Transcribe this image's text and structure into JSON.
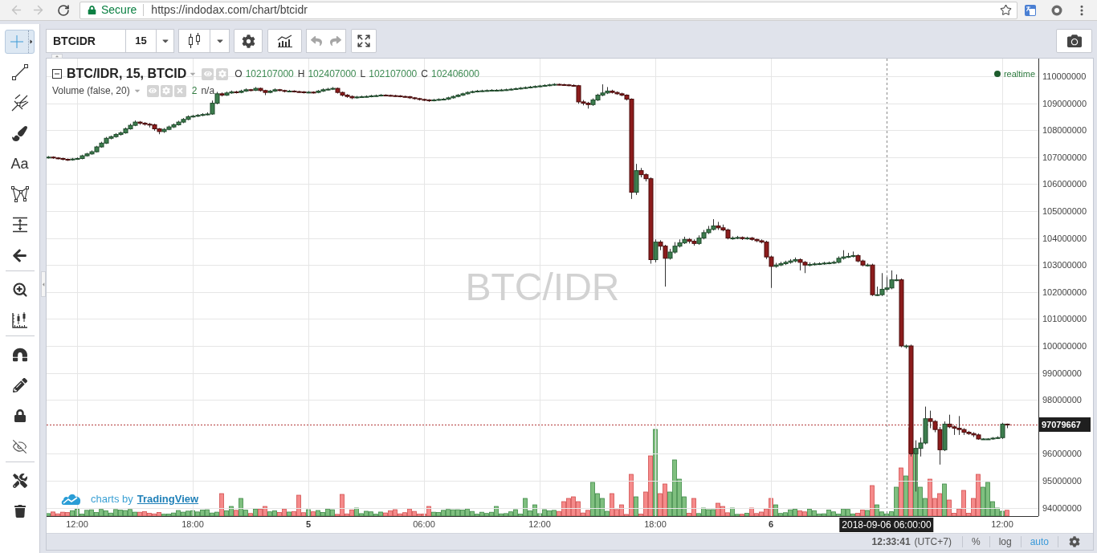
{
  "browser": {
    "nav_buttons": [
      {
        "disabled": true
      },
      {
        "disabled": true
      }
    ],
    "security_label": "Secure",
    "url": "https://indodax.com/chart/btcidr"
  },
  "top_toolbar": {
    "symbol": "BTCIDR",
    "interval": "15",
    "history_buttons": [
      {
        "disabled": true
      },
      {
        "disabled": true
      }
    ]
  },
  "left_toolbar": {
    "groups": [
      [
        {
          "kind": "icon",
          "selected": true
        },
        {
          "kind": "icon",
          "selected": false
        },
        {
          "kind": "icon",
          "selected": false
        },
        {
          "kind": "icon",
          "selected": false
        },
        {
          "kind": "text",
          "label": "Aa",
          "selected": false
        },
        {
          "kind": "icon",
          "selected": false
        },
        {
          "kind": "icon",
          "selected": false
        },
        {
          "kind": "icon",
          "selected": false
        }
      ],
      [
        {
          "kind": "icon",
          "selected": false
        },
        {
          "kind": "icon",
          "selected": false
        }
      ],
      [
        {
          "kind": "icon",
          "selected": false
        },
        {
          "kind": "icon",
          "selected": false
        },
        {
          "kind": "icon",
          "selected": false
        },
        {
          "kind": "icon",
          "selected": false
        }
      ],
      [
        {
          "kind": "icon",
          "selected": false
        },
        {
          "kind": "icon",
          "selected": false
        }
      ]
    ]
  },
  "legend": {
    "title": "BTC/IDR, 15, BTCID",
    "ohlc": [
      {
        "label": "O",
        "value": "102107000"
      },
      {
        "label": "H",
        "value": "102407000"
      },
      {
        "label": "L",
        "value": "102107000"
      },
      {
        "label": "C",
        "value": "102406000"
      }
    ],
    "volume_title": "Volume (false, 20)",
    "volume_value": "2",
    "volume_note": "n/a"
  },
  "realtime_label": "realtime",
  "watermark": "BTC/IDR",
  "attribution": {
    "text": "charts by",
    "link": "TradingView"
  },
  "price_chart": {
    "crosshair_time": "2018-09-06 06:00:00",
    "last_price": "97079667",
    "chart_data": {
      "type": "candlestick",
      "grid": true,
      "xlim": [
        "2018-09-04 10:25:00",
        "2018-09-06 13:52:30"
      ],
      "ylim": [
        93690500,
        110654800
      ],
      "xticks": [
        {
          "value": "2018-09-04 12:00",
          "label": "12:00"
        },
        {
          "value": "2018-09-04 18:00",
          "label": "18:00"
        },
        {
          "value": "2018-09-05 00:00",
          "label": "5"
        },
        {
          "value": "2018-09-05 06:00",
          "label": "06:00"
        },
        {
          "value": "2018-09-05 12:00",
          "label": "12:00"
        },
        {
          "value": "2018-09-05 18:00",
          "label": "18:00"
        },
        {
          "value": "2018-09-06 00:00",
          "label": "6"
        },
        {
          "value": "2018-09-06 12:00",
          "label": "12:00"
        }
      ],
      "yticks": [
        {
          "value": 110000000,
          "label": "110000000"
        },
        {
          "value": 109000000,
          "label": "109000000"
        },
        {
          "value": 108000000,
          "label": "108000000"
        },
        {
          "value": 107000000,
          "label": "107000000"
        },
        {
          "value": 106000000,
          "label": "106000000"
        },
        {
          "value": 105000000,
          "label": "105000000"
        },
        {
          "value": 104000000,
          "label": "104000000"
        },
        {
          "value": 103000000,
          "label": "103000000"
        },
        {
          "value": 102000000,
          "label": "102000000"
        },
        {
          "value": 101000000,
          "label": "101000000"
        },
        {
          "value": 100000000,
          "label": "100000000"
        },
        {
          "value": 99000000,
          "label": "99000000"
        },
        {
          "value": 98000000,
          "label": "98000000"
        },
        {
          "value": 96000000,
          "label": "96000000"
        },
        {
          "value": 95000000,
          "label": "95000000"
        },
        {
          "value": 94000000,
          "label": "94000000"
        }
      ],
      "x": [
        "2018-09-04 10:30",
        "2018-09-04 10:45",
        "2018-09-04 11:00",
        "2018-09-04 11:15",
        "2018-09-04 11:30",
        "2018-09-04 11:45",
        "2018-09-04 12:00",
        "2018-09-04 12:15",
        "2018-09-04 12:30",
        "2018-09-04 12:45",
        "2018-09-04 13:00",
        "2018-09-04 13:15",
        "2018-09-04 13:30",
        "2018-09-04 13:45",
        "2018-09-04 14:00",
        "2018-09-04 14:15",
        "2018-09-04 14:30",
        "2018-09-04 14:45",
        "2018-09-04 15:00",
        "2018-09-04 15:15",
        "2018-09-04 15:30",
        "2018-09-04 15:45",
        "2018-09-04 16:00",
        "2018-09-04 16:15",
        "2018-09-04 16:30",
        "2018-09-04 16:45",
        "2018-09-04 17:00",
        "2018-09-04 17:15",
        "2018-09-04 17:30",
        "2018-09-04 17:45",
        "2018-09-04 18:00",
        "2018-09-04 18:15",
        "2018-09-04 18:30",
        "2018-09-04 18:45",
        "2018-09-04 19:00",
        "2018-09-04 19:15",
        "2018-09-04 19:30",
        "2018-09-04 19:45",
        "2018-09-04 20:00",
        "2018-09-04 20:15",
        "2018-09-04 20:30",
        "2018-09-04 20:45",
        "2018-09-04 21:00",
        "2018-09-04 21:15",
        "2018-09-04 21:30",
        "2018-09-04 21:45",
        "2018-09-04 22:00",
        "2018-09-04 22:15",
        "2018-09-04 22:30",
        "2018-09-04 22:45",
        "2018-09-04 23:00",
        "2018-09-04 23:15",
        "2018-09-04 23:30",
        "2018-09-04 23:45",
        "2018-09-05 00:00",
        "2018-09-05 00:15",
        "2018-09-05 00:30",
        "2018-09-05 00:45",
        "2018-09-05 01:00",
        "2018-09-05 01:15",
        "2018-09-05 01:30",
        "2018-09-05 01:45",
        "2018-09-05 02:00",
        "2018-09-05 02:15",
        "2018-09-05 02:30",
        "2018-09-05 02:45",
        "2018-09-05 03:00",
        "2018-09-05 03:15",
        "2018-09-05 03:30",
        "2018-09-05 03:45",
        "2018-09-05 04:00",
        "2018-09-05 04:15",
        "2018-09-05 04:30",
        "2018-09-05 04:45",
        "2018-09-05 05:00",
        "2018-09-05 05:15",
        "2018-09-05 05:30",
        "2018-09-05 05:45",
        "2018-09-05 06:00",
        "2018-09-05 06:15",
        "2018-09-05 06:30",
        "2018-09-05 06:45",
        "2018-09-05 07:00",
        "2018-09-05 07:15",
        "2018-09-05 07:30",
        "2018-09-05 07:45",
        "2018-09-05 08:00",
        "2018-09-05 08:15",
        "2018-09-05 08:30",
        "2018-09-05 08:45",
        "2018-09-05 09:00",
        "2018-09-05 09:15",
        "2018-09-05 09:30",
        "2018-09-05 09:45",
        "2018-09-05 10:00",
        "2018-09-05 10:15",
        "2018-09-05 10:30",
        "2018-09-05 10:45",
        "2018-09-05 11:00",
        "2018-09-05 11:15",
        "2018-09-05 11:30",
        "2018-09-05 11:45",
        "2018-09-05 12:00",
        "2018-09-05 12:15",
        "2018-09-05 12:30",
        "2018-09-05 12:45",
        "2018-09-05 13:00",
        "2018-09-05 13:15",
        "2018-09-05 13:30",
        "2018-09-05 13:45",
        "2018-09-05 14:00",
        "2018-09-05 14:15",
        "2018-09-05 14:30",
        "2018-09-05 14:45",
        "2018-09-05 15:00",
        "2018-09-05 15:15",
        "2018-09-05 15:30",
        "2018-09-05 15:45",
        "2018-09-05 16:00",
        "2018-09-05 16:15",
        "2018-09-05 16:30",
        "2018-09-05 16:45",
        "2018-09-05 17:00",
        "2018-09-05 17:15",
        "2018-09-05 17:30",
        "2018-09-05 17:45",
        "2018-09-05 18:00",
        "2018-09-05 18:15",
        "2018-09-05 18:30",
        "2018-09-05 18:45",
        "2018-09-05 19:00",
        "2018-09-05 19:15",
        "2018-09-05 19:30",
        "2018-09-05 19:45",
        "2018-09-05 20:00",
        "2018-09-05 20:15",
        "2018-09-05 20:30",
        "2018-09-05 20:45",
        "2018-09-05 21:00",
        "2018-09-05 21:15",
        "2018-09-05 21:30",
        "2018-09-05 21:45",
        "2018-09-05 22:00",
        "2018-09-05 22:15",
        "2018-09-05 22:30",
        "2018-09-05 22:45",
        "2018-09-05 23:00",
        "2018-09-05 23:15",
        "2018-09-05 23:30",
        "2018-09-05 23:45",
        "2018-09-06 00:00",
        "2018-09-06 00:15",
        "2018-09-06 00:30",
        "2018-09-06 00:45",
        "2018-09-06 01:00",
        "2018-09-06 01:15",
        "2018-09-06 01:30",
        "2018-09-06 01:45",
        "2018-09-06 02:00",
        "2018-09-06 02:15",
        "2018-09-06 02:30",
        "2018-09-06 02:45",
        "2018-09-06 03:00",
        "2018-09-06 03:15",
        "2018-09-06 03:30",
        "2018-09-06 03:45",
        "2018-09-06 04:00",
        "2018-09-06 04:15",
        "2018-09-06 04:30",
        "2018-09-06 04:45",
        "2018-09-06 05:00",
        "2018-09-06 05:15",
        "2018-09-06 05:30",
        "2018-09-06 05:45",
        "2018-09-06 06:00",
        "2018-09-06 06:15",
        "2018-09-06 06:30",
        "2018-09-06 06:45",
        "2018-09-06 07:00",
        "2018-09-06 07:15",
        "2018-09-06 07:30",
        "2018-09-06 07:45",
        "2018-09-06 08:00",
        "2018-09-06 08:15",
        "2018-09-06 08:30",
        "2018-09-06 08:45",
        "2018-09-06 09:00",
        "2018-09-06 09:15",
        "2018-09-06 09:30",
        "2018-09-06 09:45",
        "2018-09-06 10:00",
        "2018-09-06 10:15",
        "2018-09-06 10:30",
        "2018-09-06 10:45",
        "2018-09-06 11:00",
        "2018-09-06 11:15",
        "2018-09-06 11:30",
        "2018-09-06 11:45",
        "2018-09-06 12:00",
        "2018-09-06 12:15"
      ],
      "ohlc": [
        [
          106980000,
          107040000,
          106950000,
          107000000
        ],
        [
          107000000,
          107030000,
          106940000,
          106970000
        ],
        [
          106970000,
          107000000,
          106920000,
          106950000
        ],
        [
          106950000,
          106980000,
          106880000,
          106920000
        ],
        [
          106920000,
          106950000,
          106860000,
          106900000
        ],
        [
          106900000,
          106970000,
          106870000,
          106930000
        ],
        [
          106930000,
          106990000,
          106900000,
          106950000
        ],
        [
          106950000,
          107090000,
          106920000,
          107050000
        ],
        [
          107050000,
          107160000,
          107020000,
          107120000
        ],
        [
          107120000,
          107250000,
          107090000,
          107200000
        ],
        [
          107200000,
          107420000,
          107170000,
          107380000
        ],
        [
          107380000,
          107570000,
          107350000,
          107520000
        ],
        [
          107520000,
          107750000,
          107490000,
          107700000
        ],
        [
          107700000,
          107800000,
          107660000,
          107760000
        ],
        [
          107760000,
          107890000,
          107720000,
          107840000
        ],
        [
          107840000,
          107950000,
          107800000,
          107900000
        ],
        [
          107900000,
          108100000,
          107870000,
          108050000
        ],
        [
          108050000,
          108240000,
          108020000,
          108180000
        ],
        [
          108180000,
          108360000,
          108150000,
          108300000
        ],
        [
          108300000,
          108340000,
          108200000,
          108260000
        ],
        [
          108260000,
          108300000,
          108170000,
          108220000
        ],
        [
          108220000,
          108270000,
          108100000,
          108200000
        ],
        [
          108200000,
          108240000,
          107980000,
          108050000
        ],
        [
          108050000,
          108080000,
          107850000,
          107950000
        ],
        [
          107950000,
          108080000,
          107900000,
          108030000
        ],
        [
          108030000,
          108170000,
          108000000,
          108120000
        ],
        [
          108120000,
          108250000,
          108080000,
          108200000
        ],
        [
          108200000,
          108350000,
          108170000,
          108300000
        ],
        [
          108300000,
          108450000,
          108260000,
          108400000
        ],
        [
          108400000,
          108550000,
          108370000,
          108500000
        ],
        [
          108500000,
          108570000,
          108470000,
          108520000
        ],
        [
          108520000,
          108600000,
          108490000,
          108550000
        ],
        [
          108550000,
          108630000,
          108520000,
          108580000
        ],
        [
          108580000,
          108660000,
          108550000,
          108600000
        ],
        [
          108600000,
          109100000,
          108570000,
          109000000
        ],
        [
          109000000,
          109420000,
          108960000,
          109350000
        ],
        [
          109350000,
          109400000,
          109250000,
          109300000
        ],
        [
          109300000,
          109430000,
          109270000,
          109380000
        ],
        [
          109380000,
          109470000,
          109350000,
          109420000
        ],
        [
          109420000,
          109460000,
          109360000,
          109400000
        ],
        [
          109400000,
          109500000,
          109370000,
          109450000
        ],
        [
          109450000,
          109550000,
          109420000,
          109500000
        ],
        [
          109500000,
          109530000,
          109440000,
          109480000
        ],
        [
          109480000,
          109600000,
          109450000,
          109550000
        ],
        [
          109550000,
          109580000,
          109430000,
          109470000
        ],
        [
          109470000,
          109500000,
          109300000,
          109400000
        ],
        [
          109400000,
          109490000,
          109370000,
          109450000
        ],
        [
          109450000,
          109550000,
          109420000,
          109500000
        ],
        [
          109500000,
          109530000,
          109440000,
          109470000
        ],
        [
          109470000,
          109500000,
          109400000,
          109440000
        ],
        [
          109440000,
          109490000,
          109410000,
          109450000
        ],
        [
          109450000,
          109480000,
          109400000,
          109430000
        ],
        [
          109430000,
          109460000,
          109390000,
          109420000
        ],
        [
          109420000,
          109450000,
          109360000,
          109400000
        ],
        [
          109400000,
          109450000,
          109370000,
          109410000
        ],
        [
          109410000,
          109440000,
          109360000,
          109400000
        ],
        [
          109400000,
          109490000,
          109370000,
          109450000
        ],
        [
          109450000,
          109550000,
          109420000,
          109500000
        ],
        [
          109500000,
          109570000,
          109470000,
          109520000
        ],
        [
          109520000,
          109600000,
          109490000,
          109550000
        ],
        [
          109550000,
          109580000,
          109360000,
          109400000
        ],
        [
          109400000,
          109430000,
          109250000,
          109300000
        ],
        [
          109300000,
          109340000,
          109200000,
          109250000
        ],
        [
          109250000,
          109290000,
          109150000,
          109200000
        ],
        [
          109200000,
          109270000,
          109170000,
          109230000
        ],
        [
          109230000,
          109280000,
          109200000,
          109240000
        ],
        [
          109240000,
          109290000,
          109210000,
          109250000
        ],
        [
          109250000,
          109310000,
          109220000,
          109270000
        ],
        [
          109270000,
          109320000,
          109240000,
          109280000
        ],
        [
          109280000,
          109340000,
          109250000,
          109300000
        ],
        [
          109300000,
          109330000,
          109260000,
          109290000
        ],
        [
          109290000,
          109320000,
          109250000,
          109280000
        ],
        [
          109280000,
          109310000,
          109240000,
          109270000
        ],
        [
          109270000,
          109300000,
          109220000,
          109250000
        ],
        [
          109250000,
          109280000,
          109210000,
          109240000
        ],
        [
          109240000,
          109270000,
          109160000,
          109200000
        ],
        [
          109200000,
          109230000,
          109130000,
          109170000
        ],
        [
          109170000,
          109200000,
          109100000,
          109140000
        ],
        [
          109140000,
          109170000,
          109080000,
          109120000
        ],
        [
          109120000,
          109150000,
          109050000,
          109100000
        ],
        [
          109100000,
          109160000,
          109070000,
          109120000
        ],
        [
          109120000,
          109180000,
          109090000,
          109140000
        ],
        [
          109140000,
          109190000,
          109110000,
          109150000
        ],
        [
          109150000,
          109240000,
          109120000,
          109200000
        ],
        [
          109200000,
          109290000,
          109170000,
          109250000
        ],
        [
          109250000,
          109340000,
          109220000,
          109300000
        ],
        [
          109300000,
          109390000,
          109270000,
          109350000
        ],
        [
          109350000,
          109440000,
          109320000,
          109400000
        ],
        [
          109400000,
          109470000,
          109370000,
          109430000
        ],
        [
          109430000,
          109490000,
          109400000,
          109450000
        ],
        [
          109450000,
          109500000,
          109420000,
          109460000
        ],
        [
          109460000,
          109510000,
          109430000,
          109470000
        ],
        [
          109470000,
          109520000,
          109440000,
          109480000
        ],
        [
          109480000,
          109520000,
          109450000,
          109480000
        ],
        [
          109480000,
          109530000,
          109450000,
          109490000
        ],
        [
          109490000,
          109540000,
          109460000,
          109500000
        ],
        [
          109500000,
          109560000,
          109470000,
          109520000
        ],
        [
          109520000,
          109580000,
          109490000,
          109540000
        ],
        [
          109540000,
          109600000,
          109510000,
          109560000
        ],
        [
          109560000,
          109620000,
          109530000,
          109580000
        ],
        [
          109580000,
          109640000,
          109550000,
          109600000
        ],
        [
          109600000,
          109660000,
          109570000,
          109620000
        ],
        [
          109620000,
          109680000,
          109590000,
          109640000
        ],
        [
          109640000,
          109700000,
          109610000,
          109660000
        ],
        [
          109660000,
          109720000,
          109630000,
          109680000
        ],
        [
          109680000,
          109740000,
          109650000,
          109700000
        ],
        [
          109700000,
          109730000,
          109660000,
          109690000
        ],
        [
          109690000,
          109720000,
          109650000,
          109680000
        ],
        [
          109680000,
          109710000,
          109630000,
          109660000
        ],
        [
          109660000,
          109700000,
          109610000,
          109650000
        ],
        [
          109650000,
          109680000,
          108980000,
          109050000
        ],
        [
          109050000,
          109120000,
          108920000,
          109000000
        ],
        [
          109000000,
          109050000,
          108800000,
          108950000
        ],
        [
          108950000,
          109180000,
          108900000,
          109120000
        ],
        [
          109120000,
          109350000,
          109080000,
          109300000
        ],
        [
          109300000,
          109700000,
          109260000,
          109380000
        ],
        [
          109380000,
          109600000,
          109340000,
          109450000
        ],
        [
          109450000,
          109500000,
          109360000,
          109400000
        ],
        [
          109400000,
          109440000,
          109310000,
          109350000
        ],
        [
          109350000,
          109390000,
          109260000,
          109300000
        ],
        [
          109300000,
          109330000,
          109100000,
          109150000
        ],
        [
          109150000,
          109180000,
          105450000,
          105700000
        ],
        [
          105700000,
          106750000,
          105600000,
          106500000
        ],
        [
          106500000,
          106600000,
          106250000,
          106350000
        ],
        [
          106350000,
          106400000,
          106100000,
          106200000
        ],
        [
          106200000,
          106250000,
          103050000,
          103200000
        ],
        [
          103200000,
          103950000,
          103100000,
          103850000
        ],
        [
          103850000,
          103920000,
          103550000,
          103700000
        ],
        [
          103700000,
          103750000,
          102200000,
          103250000
        ],
        [
          103250000,
          103600000,
          103200000,
          103480000
        ],
        [
          103480000,
          103850000,
          103420000,
          103700000
        ],
        [
          103700000,
          103950000,
          103650000,
          103820000
        ],
        [
          103820000,
          104050000,
          103780000,
          103950000
        ],
        [
          103950000,
          104000000,
          103800000,
          103880000
        ],
        [
          103880000,
          103950000,
          103720000,
          103800000
        ],
        [
          103800000,
          104100000,
          103750000,
          104000000
        ],
        [
          104000000,
          104300000,
          103950000,
          104200000
        ],
        [
          104200000,
          104450000,
          104150000,
          104320000
        ],
        [
          104320000,
          104700000,
          104280000,
          104450000
        ],
        [
          104450000,
          104600000,
          104300000,
          104380000
        ],
        [
          104380000,
          104500000,
          104250000,
          104300000
        ],
        [
          104300000,
          104350000,
          103950000,
          104000000
        ],
        [
          104000000,
          104060000,
          103940000,
          104000000
        ],
        [
          104000000,
          104080000,
          103960000,
          104020000
        ],
        [
          104020000,
          104060000,
          103930000,
          103980000
        ],
        [
          103980000,
          104050000,
          103940000,
          104000000
        ],
        [
          104000000,
          104040000,
          103900000,
          103950000
        ],
        [
          103950000,
          103980000,
          103850000,
          103900000
        ],
        [
          103900000,
          103950000,
          103800000,
          103850000
        ],
        [
          103850000,
          103900000,
          103220000,
          103300000
        ],
        [
          103300000,
          103350000,
          102150000,
          102950000
        ],
        [
          102950000,
          103080000,
          102900000,
          103000000
        ],
        [
          103000000,
          103120000,
          102960000,
          103050000
        ],
        [
          103050000,
          103160000,
          103000000,
          103100000
        ],
        [
          103100000,
          103220000,
          103050000,
          103150000
        ],
        [
          103150000,
          103280000,
          103100000,
          103200000
        ],
        [
          103200000,
          103250000,
          102800000,
          103100000
        ],
        [
          103100000,
          103150000,
          102700000,
          103000000
        ],
        [
          103000000,
          103100000,
          102950000,
          103020000
        ],
        [
          103020000,
          103100000,
          102980000,
          103040000
        ],
        [
          103040000,
          103100000,
          103000000,
          103050000
        ],
        [
          103050000,
          103120000,
          103010000,
          103070000
        ],
        [
          103070000,
          103130000,
          103030000,
          103080000
        ],
        [
          103080000,
          103160000,
          103040000,
          103100000
        ],
        [
          103100000,
          103320000,
          103060000,
          103250000
        ],
        [
          103250000,
          103550000,
          103200000,
          103300000
        ],
        [
          103300000,
          103450000,
          103260000,
          103320000
        ],
        [
          103320000,
          103500000,
          103280000,
          103350000
        ],
        [
          103350000,
          103400000,
          103100000,
          103150000
        ],
        [
          103150000,
          103200000,
          102950000,
          103000000
        ],
        [
          103000000,
          103060000,
          102940000,
          103000000
        ],
        [
          103000000,
          103050000,
          101850000,
          101900000
        ],
        [
          101900000,
          102200000,
          101850000,
          101900000
        ],
        [
          101900000,
          102700000,
          101850000,
          102100000
        ],
        [
          102100000,
          102550000,
          102050000,
          102150000
        ],
        [
          102150000,
          102800000,
          102100000,
          102450000
        ],
        [
          102450000,
          102650000,
          102400000,
          102450000
        ],
        [
          102450000,
          102500000,
          99950000,
          100000000
        ],
        [
          100000000,
          100050000,
          99900000,
          100000000
        ],
        [
          100000000,
          100050000,
          95900000,
          96000000
        ],
        [
          96000000,
          96500000,
          94600000,
          96200000
        ],
        [
          96200000,
          96600000,
          95900000,
          96400000
        ],
        [
          96400000,
          97750000,
          96350000,
          97300000
        ],
        [
          97300000,
          97600000,
          96950000,
          97200000
        ],
        [
          97200000,
          97250000,
          96800000,
          96900000
        ],
        [
          96900000,
          97000000,
          95600000,
          96150000
        ],
        [
          96150000,
          97200000,
          96100000,
          97100000
        ],
        [
          97100000,
          97450000,
          96950000,
          97000000
        ],
        [
          97000000,
          97050000,
          96700000,
          96950000
        ],
        [
          96950000,
          97400000,
          96700000,
          96900000
        ],
        [
          96900000,
          96950000,
          96700000,
          96800000
        ],
        [
          96800000,
          96850000,
          96700000,
          96750000
        ],
        [
          96750000,
          96800000,
          96620000,
          96700000
        ],
        [
          96700000,
          96750000,
          96520000,
          96550000
        ],
        [
          96550000,
          96580000,
          96520000,
          96550000
        ],
        [
          96550000,
          96580000,
          96520000,
          96550000
        ],
        [
          96550000,
          96620000,
          96520000,
          96580000
        ],
        [
          96580000,
          96650000,
          96550000,
          96600000
        ],
        [
          96600000,
          97150000,
          96550000,
          97100000
        ],
        [
          97100000,
          97120000,
          96950000,
          97080000
        ]
      ]
    }
  },
  "status_bar": {
    "time": "12:33:41",
    "timezone": "(UTC+7)",
    "scale_buttons": [
      {
        "label": "%",
        "selected": false
      },
      {
        "label": "log",
        "selected": false
      },
      {
        "label": "auto",
        "selected": true
      }
    ]
  }
}
